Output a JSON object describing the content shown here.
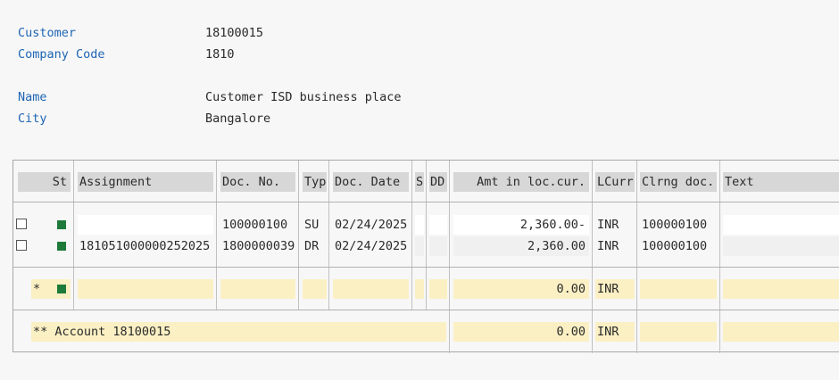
{
  "header": {
    "customer_label": "Customer",
    "customer_value": "18100015",
    "company_code_label": "Company Code",
    "company_code_value": "1810",
    "name_label": "Name",
    "name_value": "Customer ISD business place",
    "city_label": "City",
    "city_value": "Bangalore"
  },
  "columns": {
    "status": "St",
    "assignment": "Assignment",
    "doc_no": "Doc. No.",
    "type": "Typ",
    "doc_date": "Doc. Date",
    "s": "S",
    "dd": "DD",
    "amount": "Amt in loc.cur.",
    "lcurr": "LCurr",
    "clearing_doc": "Clrng doc.",
    "text": "Text"
  },
  "rows": [
    {
      "assignment": "",
      "doc_no": "100000100",
      "type": "SU",
      "doc_date": "02/24/2025",
      "amount": "2,360.00-",
      "lcurr": "INR",
      "clearing_doc": "100000100",
      "status_color": "#1e7a3a"
    },
    {
      "assignment": "181051000000252025",
      "doc_no": "1800000039",
      "type": "DR",
      "doc_date": "02/24/2025",
      "amount": "2,360.00",
      "lcurr": "INR",
      "clearing_doc": "100000100",
      "status_color": "#1e7a3a"
    }
  ],
  "subtotal": {
    "marker": "*",
    "amount": "0.00",
    "lcurr": "INR"
  },
  "total": {
    "label": "** Account 18100015",
    "amount": "0.00",
    "lcurr": "INR"
  }
}
